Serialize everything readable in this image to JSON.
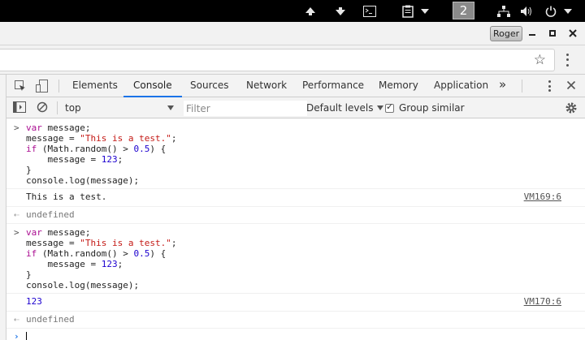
{
  "os_panel": {
    "workspace_number": "2",
    "icons": [
      "arrow-up-icon",
      "arrow-down-icon",
      "terminal-icon",
      "clipboard-icon",
      "network-icon",
      "volume-icon",
      "power-icon"
    ]
  },
  "window": {
    "profile_name": "Roger"
  },
  "devtools": {
    "tabs": [
      {
        "label": "Elements"
      },
      {
        "label": "Console"
      },
      {
        "label": "Sources"
      },
      {
        "label": "Network"
      },
      {
        "label": "Performance"
      },
      {
        "label": "Memory"
      },
      {
        "label": "Application"
      }
    ],
    "more_tabs_label": "»",
    "active_tab": "Console",
    "accent_color": "#1a73e8"
  },
  "console_toolbar": {
    "context": "top",
    "filter_placeholder": "Filter",
    "levels_label": "Default levels",
    "group_similar_label": "Group similar",
    "group_similar_checked": true
  },
  "console": {
    "entries": [
      {
        "input_lines": [
          "var message;",
          "message = \"This is a test.\";",
          "if (Math.random() > 0.5) {",
          "    message = 123;",
          "}",
          "console.log(message);"
        ],
        "log_output": "This is a test.",
        "log_source": "VM169:6",
        "result": "undefined"
      },
      {
        "input_lines": [
          "var message;",
          "message = \"This is a test.\";",
          "if (Math.random() > 0.5) {",
          "    message = 123;",
          "}",
          "console.log(message);"
        ],
        "log_output": "123",
        "log_source": "VM170:6",
        "result": "undefined"
      }
    ]
  }
}
